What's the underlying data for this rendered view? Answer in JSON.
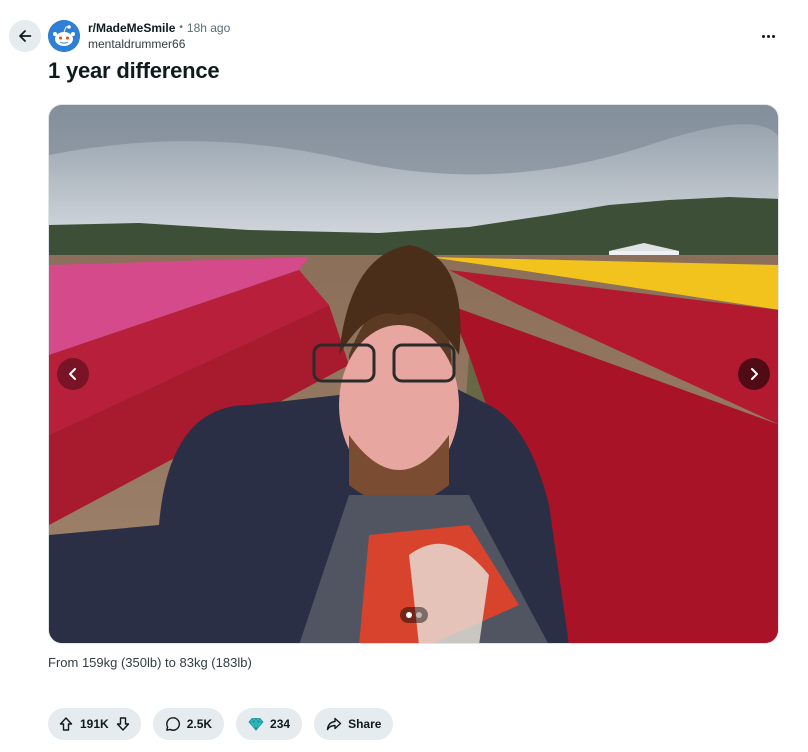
{
  "post": {
    "subreddit": "r/MadeMeSmile",
    "separator": "•",
    "time": "18h ago",
    "author": "mentaldrummer66",
    "title": "1 year difference",
    "caption": "From 159kg (350lb) to 83kg (183lb)"
  },
  "gallery": {
    "image_count": 2,
    "current_index": 1
  },
  "actions": {
    "votes": "191K",
    "comments": "2.5K",
    "awards": "234",
    "share_label": "Share"
  },
  "colors": {
    "action_bg": "#e5ebee",
    "award_gem": "#34c0c8"
  },
  "icons": {
    "back": "arrow-left-icon",
    "more": "more-horizontal-icon",
    "upvote": "arrow-up-icon",
    "downvote": "arrow-down-icon",
    "comment": "comment-bubble-icon",
    "award": "gem-icon",
    "share": "share-arrow-icon",
    "prev": "chevron-left-icon",
    "next": "chevron-right-icon"
  }
}
